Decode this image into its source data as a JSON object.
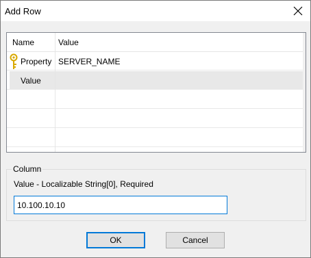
{
  "dialog": {
    "title": "Add Row",
    "close_icon": "close-icon"
  },
  "grid": {
    "columns": [
      "Name",
      "Value"
    ],
    "rows": [
      {
        "name": "Property",
        "value": "SERVER_NAME",
        "icon": "key-icon",
        "selected": false
      },
      {
        "name": "Value",
        "value": "",
        "icon": "",
        "selected": true
      },
      {
        "name": "",
        "value": ""
      },
      {
        "name": "",
        "value": ""
      },
      {
        "name": "",
        "value": ""
      }
    ]
  },
  "column_group": {
    "legend": "Column",
    "description": "Value - Localizable String[0], Required",
    "input_value": "10.100.10.10"
  },
  "buttons": {
    "ok": "OK",
    "cancel": "Cancel"
  },
  "colors": {
    "accent": "#0078d7",
    "key_icon": "#d8a800"
  }
}
